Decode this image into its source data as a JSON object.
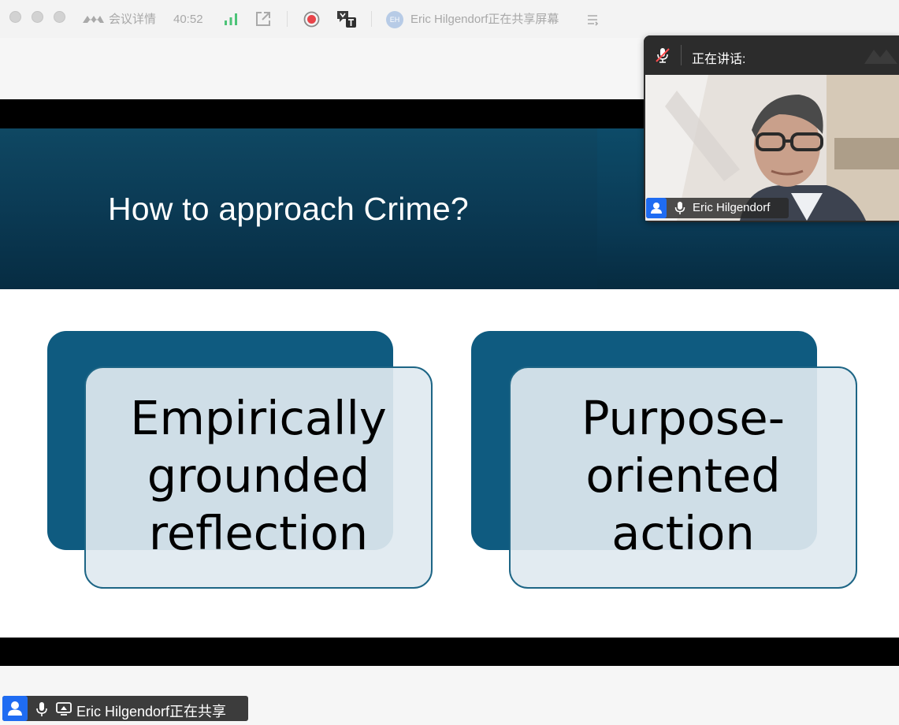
{
  "titlebar": {
    "meeting_details": "会议详情",
    "duration": "40:52",
    "share_avatar_initials": "EH",
    "share_status": "Eric Hilgendorf正在共享屏幕"
  },
  "slide": {
    "title": "How to approach Crime?",
    "cards": [
      {
        "lines": [
          "Empirically",
          "grounded",
          "reflection"
        ]
      },
      {
        "lines": [
          "Purpose-",
          "oriented",
          "action"
        ]
      }
    ],
    "colors": {
      "banner": "#0b3a54",
      "card_back": "#0f5b80",
      "card_border": "#1d6585"
    }
  },
  "speaker_panel": {
    "label": "正在讲话:",
    "name": "Eric Hilgendorf"
  },
  "bottom_status": {
    "text": "Eric Hilgendorf正在共享"
  },
  "icons": [
    "window-close-icon",
    "window-minimize-icon",
    "window-zoom-icon",
    "app-logo-icon",
    "signal-icon",
    "popout-icon",
    "record-icon",
    "translate-icon",
    "list-icon",
    "mic-muted-icon",
    "user-icon",
    "mic-icon",
    "screen-share-icon"
  ]
}
